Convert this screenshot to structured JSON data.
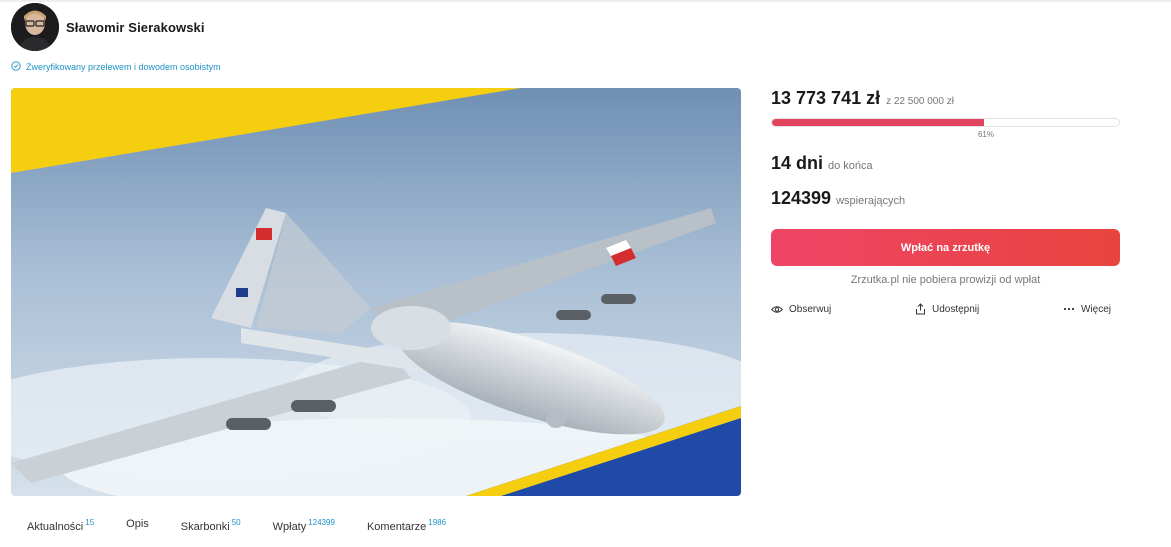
{
  "author": {
    "name": "Sławomir Sierakowski",
    "verified_text": "Zweryfikowany przelewem i dowodem osobistym"
  },
  "campaign": {
    "raised": "13 773 741 zł",
    "goal": "z 22 500 000 zł",
    "progress_percent": 61,
    "progress_label": "61%",
    "days_value": "14 dni",
    "days_label": "do końca",
    "supporters_value": "124399",
    "supporters_label": "wspierających",
    "donate_label": "Wpłać na zrzutkę",
    "nofee_text": "Zrzutka.pl nie pobiera prowizji od wpłat"
  },
  "actions": {
    "follow": "Obserwuj",
    "share": "Udostępnij",
    "more": "Więcej"
  },
  "tabs": [
    {
      "label": "Aktualności",
      "count": "15"
    },
    {
      "label": "Opis",
      "count": ""
    },
    {
      "label": "Skarbonki",
      "count": "50"
    },
    {
      "label": "Wpłaty",
      "count": "124399"
    },
    {
      "label": "Komentarze",
      "count": "1986"
    }
  ],
  "colors": {
    "accent_red": "#e2445f",
    "link_blue": "#1e93c9",
    "ukraine_yellow": "#f5cf0f",
    "ukraine_blue": "#1f4aa8"
  },
  "icons": {
    "verified": "check-circle-icon",
    "follow": "eye-icon",
    "share": "share-icon",
    "more": "more-dots-icon"
  }
}
